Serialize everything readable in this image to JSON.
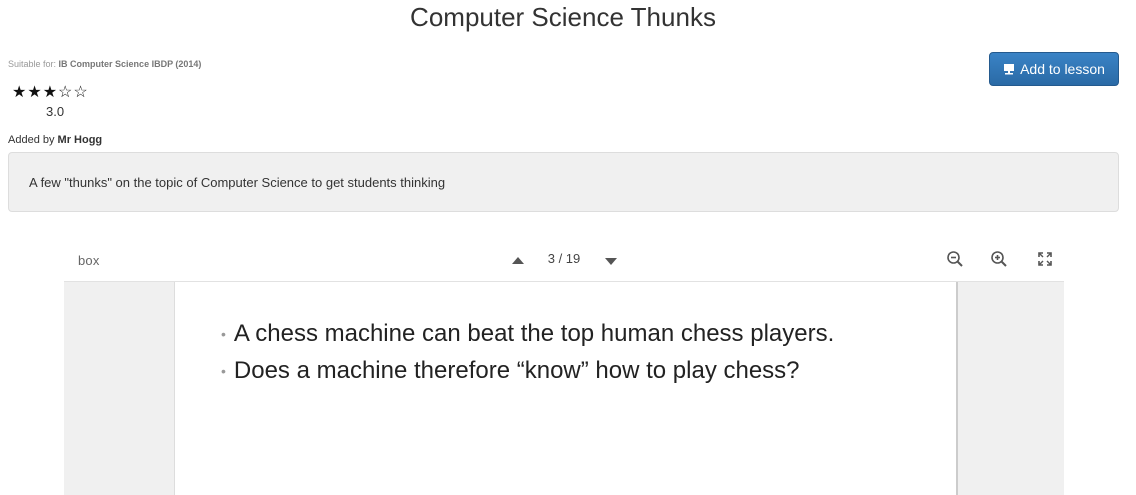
{
  "page": {
    "title": "Computer Science Thunks"
  },
  "meta": {
    "suitable_prefix": "Suitable for:",
    "suitable_value": "IB Computer Science IBDP (2014)",
    "rating_stars": "★★★☆☆",
    "rating_value": "3.0",
    "added_by_prefix": "Added by",
    "added_by_name": "Mr Hogg"
  },
  "actions": {
    "add_to_lesson_label": "Add to lesson",
    "add_to_lesson_icon": "lesson-board-icon"
  },
  "description": {
    "text": "A few \"thunks\" on the topic of Computer Science to get students thinking"
  },
  "viewer": {
    "logo_text": "box",
    "page_counter": "3 / 19",
    "icons": [
      "chevron-up-icon",
      "chevron-down-icon",
      "zoom-out-icon",
      "zoom-in-icon",
      "fullscreen-icon"
    ],
    "slide": {
      "bullets": [
        "A chess machine can beat the top human chess players.",
        "Does a machine therefore “know” how to play chess?"
      ]
    }
  },
  "colors": {
    "button_bg": "#2f75b5",
    "description_bg": "#f0f0f0",
    "viewer_bg": "#f0f0f0"
  }
}
